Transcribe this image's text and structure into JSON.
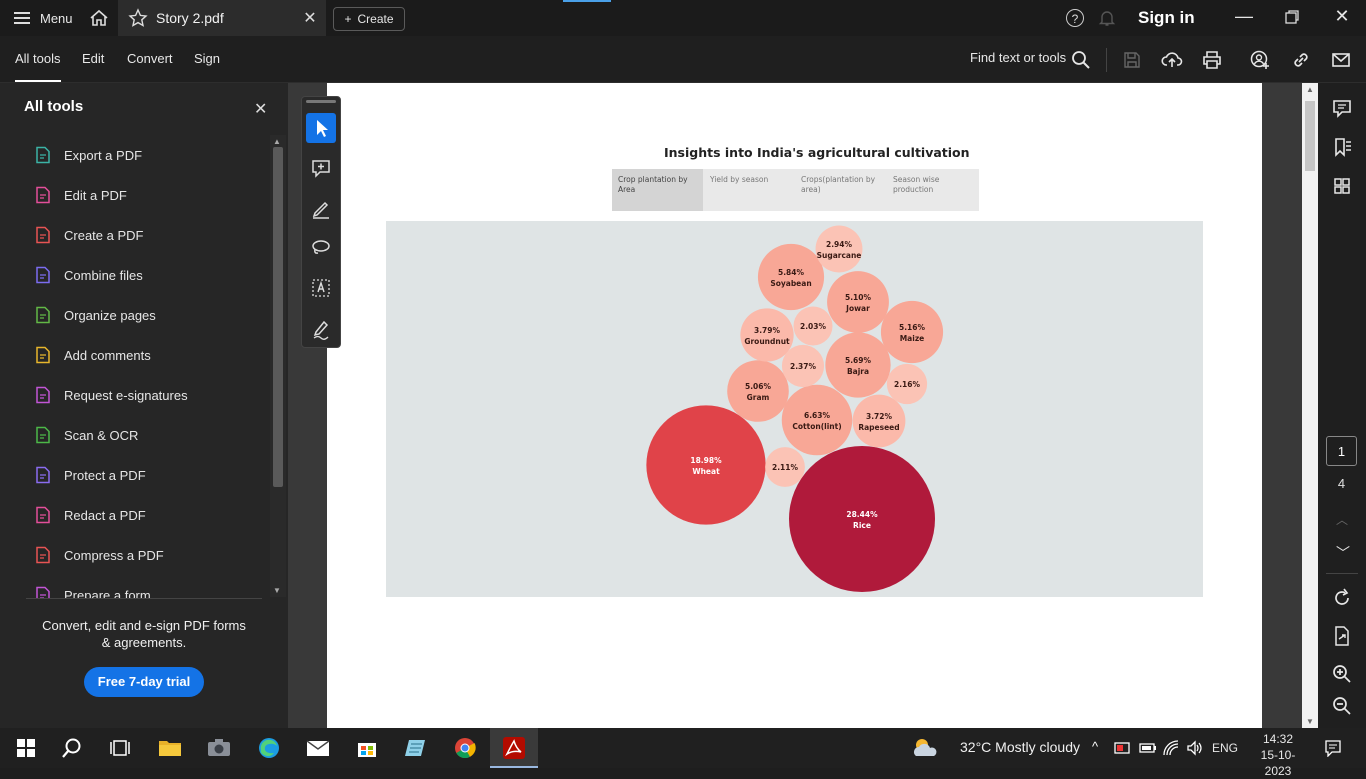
{
  "titlebar": {
    "menu_label": "Menu",
    "tab_title": "Story 2.pdf",
    "create_label": "Create",
    "sign_in": "Sign in",
    "help_glyph": "?"
  },
  "toolbar": {
    "tabs": [
      "All tools",
      "Edit",
      "Convert",
      "Sign"
    ],
    "find_label": "Find text or tools",
    "icons": [
      "search-icon",
      "save-icon",
      "upload-cloud-icon",
      "print-icon",
      "share-user-icon",
      "link-icon",
      "email-icon"
    ]
  },
  "left_panel": {
    "title": "All tools",
    "tools": [
      {
        "label": "Export a PDF",
        "icon": "export-pdf-icon",
        "color": "#3bb3a6"
      },
      {
        "label": "Edit a PDF",
        "icon": "edit-pdf-icon",
        "color": "#e34f9a"
      },
      {
        "label": "Create a PDF",
        "icon": "create-pdf-icon",
        "color": "#e85454"
      },
      {
        "label": "Combine files",
        "icon": "combine-files-icon",
        "color": "#7b6cf0"
      },
      {
        "label": "Organize pages",
        "icon": "organize-pages-icon",
        "color": "#62b846"
      },
      {
        "label": "Add comments",
        "icon": "add-comments-icon",
        "color": "#e8b62c"
      },
      {
        "label": "Request e-signatures",
        "icon": "request-esign-icon",
        "color": "#c255d6"
      },
      {
        "label": "Scan & OCR",
        "icon": "scan-ocr-icon",
        "color": "#4cb848"
      },
      {
        "label": "Protect a PDF",
        "icon": "protect-pdf-icon",
        "color": "#8a6cf0"
      },
      {
        "label": "Redact a PDF",
        "icon": "redact-pdf-icon",
        "color": "#e34f9a"
      },
      {
        "label": "Compress a PDF",
        "icon": "compress-pdf-icon",
        "color": "#e85454"
      },
      {
        "label": "Prepare a form",
        "icon": "prepare-form-icon",
        "color": "#c255d6"
      }
    ],
    "promo_text": "Convert, edit and e-sign PDF forms & agreements.",
    "trial_button": "Free 7-day trial"
  },
  "document": {
    "story_title": "Insights into India's agricultural cultivation",
    "story_tabs": [
      "Crop plantation by Area",
      "Yield by season",
      "Crops(plantation by area)",
      "Season wise production"
    ],
    "active_tab": 0
  },
  "chart_data": {
    "type": "bubble",
    "title": "",
    "bubbles": [
      {
        "label": "28.44%",
        "name": "Rice",
        "value": 28.44,
        "color": "#b01a3b"
      },
      {
        "label": "18.98%",
        "name": "Wheat",
        "value": 18.98,
        "color": "#e04349"
      },
      {
        "label": "6.63%",
        "name": "Cotton(lint)",
        "value": 6.63,
        "color": "#f8a796"
      },
      {
        "label": "5.84%",
        "name": "Soyabean",
        "value": 5.84,
        "color": "#f8a796"
      },
      {
        "label": "5.69%",
        "name": "Bajra",
        "value": 5.69,
        "color": "#f8a796"
      },
      {
        "label": "5.16%",
        "name": "Maize",
        "value": 5.16,
        "color": "#f8a796"
      },
      {
        "label": "5.10%",
        "name": "Jowar",
        "value": 5.1,
        "color": "#f8a796"
      },
      {
        "label": "5.06%",
        "name": "Gram",
        "value": 5.06,
        "color": "#f8a796"
      },
      {
        "label": "3.79%",
        "name": "Groundnut",
        "value": 3.79,
        "color": "#fbb9aa"
      },
      {
        "label": "3.72%",
        "name": "Rapeseed",
        "value": 3.72,
        "color": "#fbb9aa"
      },
      {
        "label": "2.94%",
        "name": "Sugarcane",
        "value": 2.94,
        "color": "#fbc3b5"
      },
      {
        "label": "2.37%",
        "name": "",
        "value": 2.37,
        "color": "#fbc3b5"
      },
      {
        "label": "2.16%",
        "name": "",
        "value": 2.16,
        "color": "#fbc3b5"
      },
      {
        "label": "2.11%",
        "name": "",
        "value": 2.11,
        "color": "#fbc3b5"
      },
      {
        "label": "2.03%",
        "name": "",
        "value": 2.03,
        "color": "#fbc3b5"
      }
    ]
  },
  "right_rail": {
    "current_page": "1",
    "page_count": "4"
  },
  "taskbar": {
    "weather": "32°C  Mostly cloudy",
    "lang": "ENG",
    "time": "14:32",
    "date": "15-10-2023"
  }
}
